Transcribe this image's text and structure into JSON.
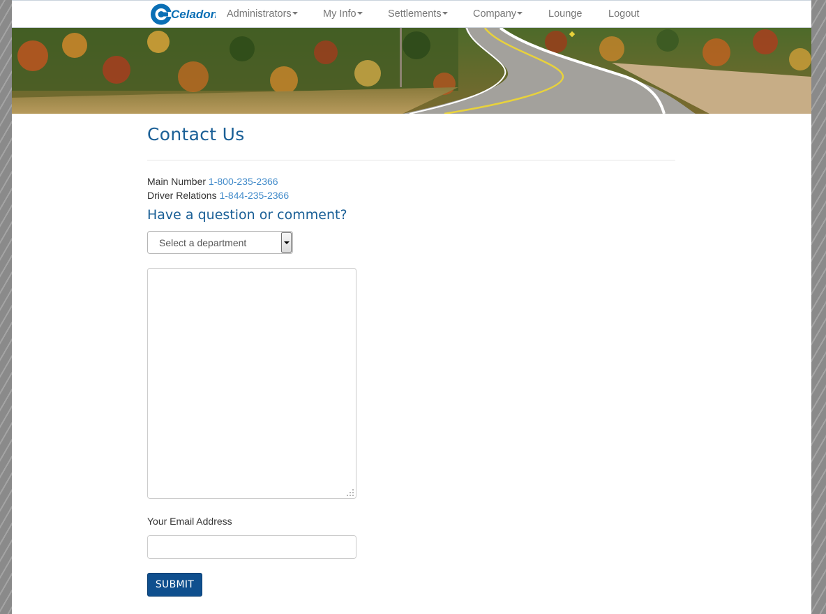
{
  "nav": {
    "logo_text": "Celadon",
    "items": [
      {
        "label": "Administrators",
        "dropdown": true
      },
      {
        "label": "My Info",
        "dropdown": true
      },
      {
        "label": "Settlements",
        "dropdown": true
      },
      {
        "label": "Company",
        "dropdown": true
      },
      {
        "label": "Lounge",
        "dropdown": false
      },
      {
        "label": "Logout",
        "dropdown": false
      }
    ]
  },
  "page": {
    "title": "Contact Us"
  },
  "contacts": [
    {
      "label": "Main Number",
      "phone": "1-800-235-2366"
    },
    {
      "label": "Driver Relations",
      "phone": "1-844-235-2366"
    }
  ],
  "form": {
    "heading": "Have a question or comment?",
    "department_select": {
      "selected": "Select a department"
    },
    "message_value": "",
    "email_label": "Your Email Address",
    "email_value": "",
    "submit_label": "SUBMIT"
  },
  "colors": {
    "brand_blue": "#1a5f96",
    "link_blue": "#428bca",
    "button_blue": "#0f4f8e",
    "logo_blue": "#0a6fb5"
  }
}
